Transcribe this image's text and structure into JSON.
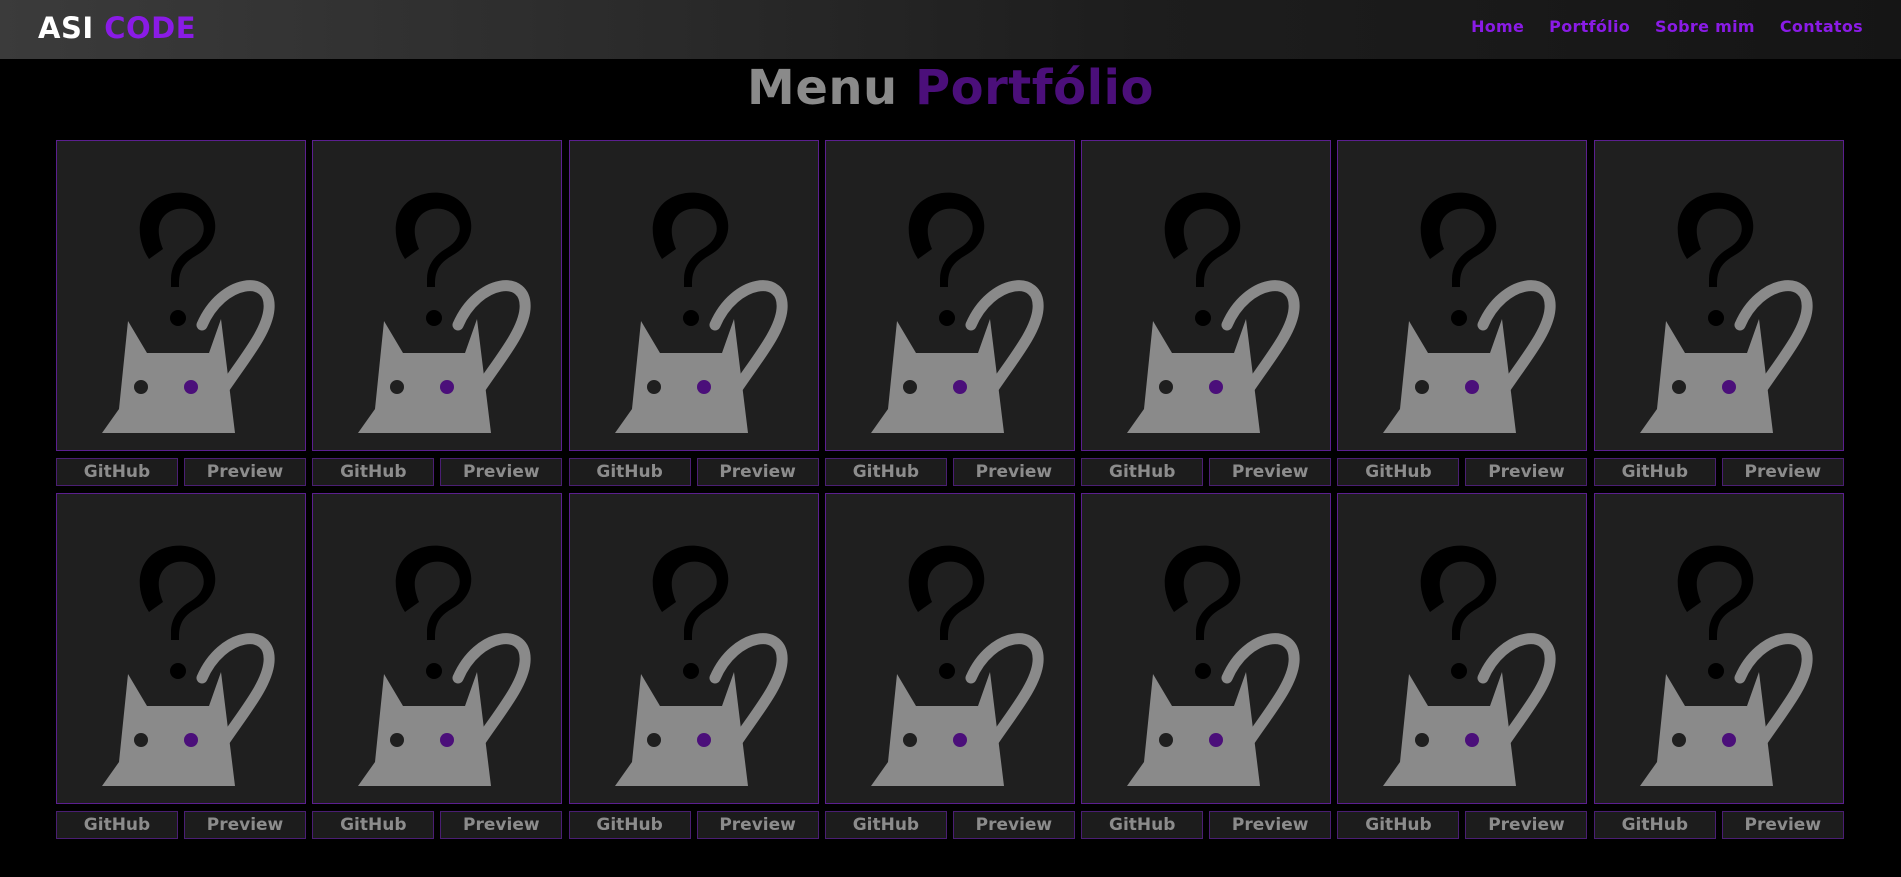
{
  "colors": {
    "accent_purple": "#8a1be6",
    "dark_purple": "#4b0f7a",
    "card_bg": "#1f1f1f",
    "card_border": "#5b1f8f",
    "placeholder_gray": "#8a8a8a"
  },
  "header": {
    "logo_part1": "ASI",
    "logo_part2": "CODE",
    "nav": [
      "Home",
      "Portfólio",
      "Sobre mim",
      "Contatos"
    ]
  },
  "page": {
    "title_part1": "Menu",
    "title_part2": "Portfólio"
  },
  "projects": [
    {
      "image": "placeholder-cat-question-icon",
      "github_label": "GitHub",
      "preview_label": "Preview"
    },
    {
      "image": "placeholder-cat-question-icon",
      "github_label": "GitHub",
      "preview_label": "Preview"
    },
    {
      "image": "placeholder-cat-question-icon",
      "github_label": "GitHub",
      "preview_label": "Preview"
    },
    {
      "image": "placeholder-cat-question-icon",
      "github_label": "GitHub",
      "preview_label": "Preview"
    },
    {
      "image": "placeholder-cat-question-icon",
      "github_label": "GitHub",
      "preview_label": "Preview"
    },
    {
      "image": "placeholder-cat-question-icon",
      "github_label": "GitHub",
      "preview_label": "Preview"
    },
    {
      "image": "placeholder-cat-question-icon",
      "github_label": "GitHub",
      "preview_label": "Preview"
    },
    {
      "image": "placeholder-cat-question-icon",
      "github_label": "GitHub",
      "preview_label": "Preview"
    },
    {
      "image": "placeholder-cat-question-icon",
      "github_label": "GitHub",
      "preview_label": "Preview"
    },
    {
      "image": "placeholder-cat-question-icon",
      "github_label": "GitHub",
      "preview_label": "Preview"
    },
    {
      "image": "placeholder-cat-question-icon",
      "github_label": "GitHub",
      "preview_label": "Preview"
    },
    {
      "image": "placeholder-cat-question-icon",
      "github_label": "GitHub",
      "preview_label": "Preview"
    },
    {
      "image": "placeholder-cat-question-icon",
      "github_label": "GitHub",
      "preview_label": "Preview"
    },
    {
      "image": "placeholder-cat-question-icon",
      "github_label": "GitHub",
      "preview_label": "Preview"
    }
  ]
}
